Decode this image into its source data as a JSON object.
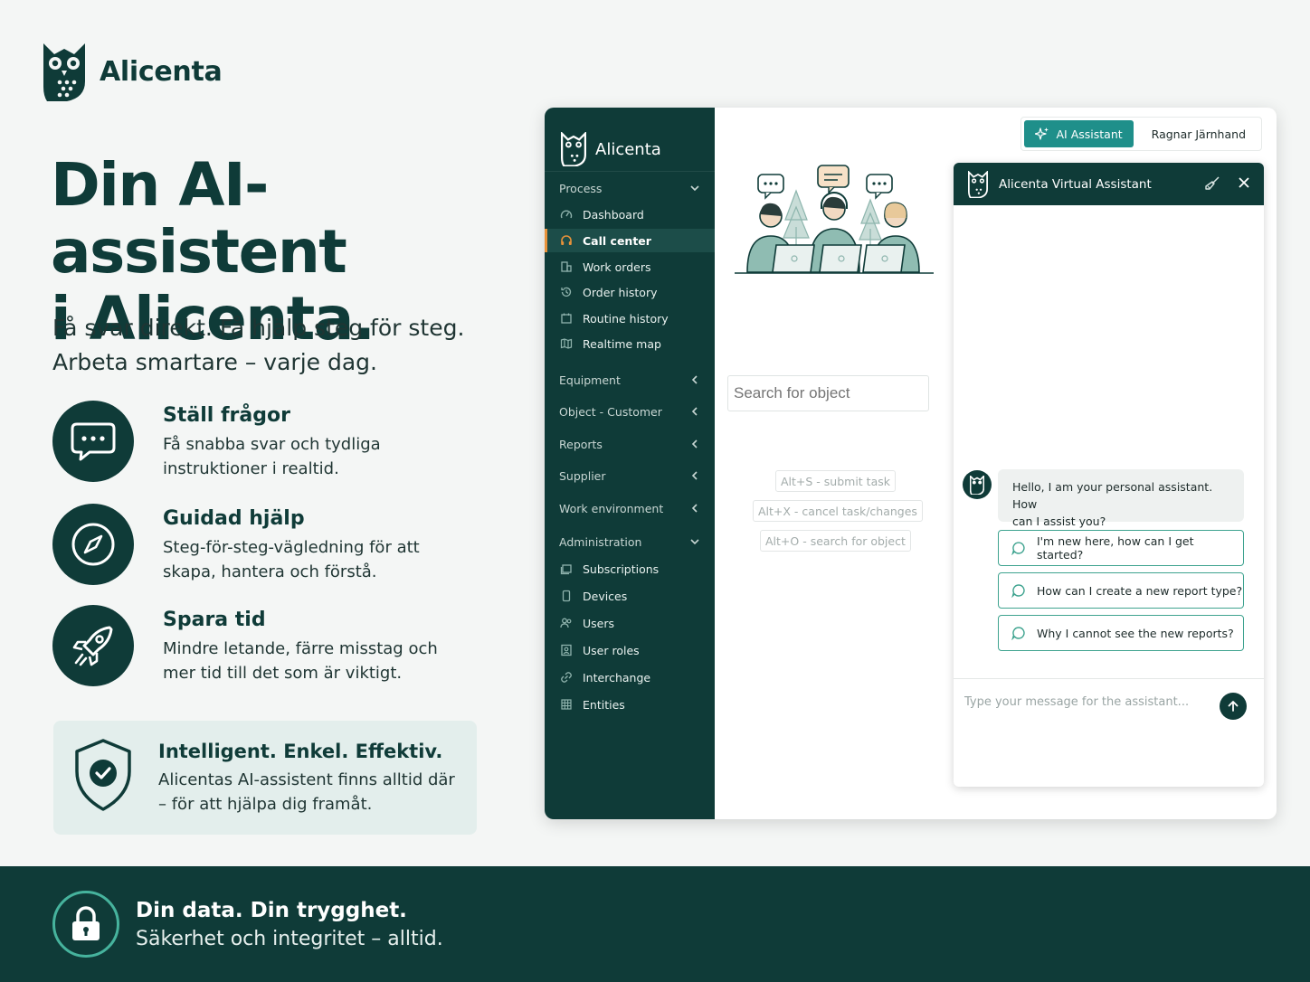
{
  "brand": {
    "name": "Alicenta"
  },
  "hero": {
    "headline": [
      "Din AI-assistent",
      "i Alicenta."
    ],
    "subtitle": [
      "Få svar direkt. Få hjälp steg för steg.",
      "Arbeta smartare – varje dag."
    ]
  },
  "features": [
    {
      "title": "Ställ frågor",
      "desc": [
        "Få snabba svar och tydliga",
        "instruktioner i realtid."
      ],
      "icon": "chat-bubble-icon"
    },
    {
      "title": "Guidad hjälp",
      "desc": [
        "Steg-för-steg-vägledning för att",
        "skapa, hantera och förstå."
      ],
      "icon": "compass-icon"
    },
    {
      "title": "Spara tid",
      "desc": [
        "Mindre letande, färre misstag och",
        "mer tid till det som är viktigt."
      ],
      "icon": "rocket-icon"
    }
  ],
  "callout": {
    "title": "Intelligent. Enkel. Effektiv.",
    "desc": [
      "Alicentas AI-assistent finns alltid där",
      "– för att hjälpa dig framåt."
    ],
    "icon": "shield-check-icon"
  },
  "footer": {
    "title": "Din data. Din trygghet.",
    "desc": "Säkerhet och integritet – alltid.",
    "icon": "lock-icon"
  },
  "app": {
    "brand": "Alicenta",
    "sidebar": {
      "process": {
        "label": "Process",
        "items": [
          "Dashboard",
          "Call center",
          "Work orders",
          "Order history",
          "Routine history",
          "Realtime map"
        ],
        "active": "Call center"
      },
      "groups": [
        "Equipment",
        "Object - Customer",
        "Reports",
        "Supplier",
        "Work environment"
      ],
      "administration": {
        "label": "Administration",
        "items": [
          "Subscriptions",
          "Devices",
          "Users",
          "User roles",
          "Interchange",
          "Entities"
        ]
      }
    },
    "topbar": {
      "ai_button": "AI Assistant",
      "user": "Ragnar Järnhand"
    },
    "search": {
      "placeholder": "Search for object"
    },
    "shortcuts": [
      "Alt+S - submit task",
      "Alt+X - cancel task/changes",
      "Alt+O - search for object"
    ],
    "chat": {
      "title": "Alicenta Virtual Assistant",
      "greeting": [
        "Hello, I am your personal assistant. How",
        "can I assist you?"
      ],
      "suggestions": [
        "I'm new here, how can I get started?",
        "How can I create a new report type?",
        "Why I cannot see the new reports?"
      ],
      "input_placeholder": "Type your message for the assistant..."
    }
  },
  "colors": {
    "primary": "#0f3b38",
    "accent": "#1f8f8a",
    "active_marker": "#e8923a",
    "suggestion_border": "#3ea38f",
    "page_bg": "#f4f6f5"
  }
}
